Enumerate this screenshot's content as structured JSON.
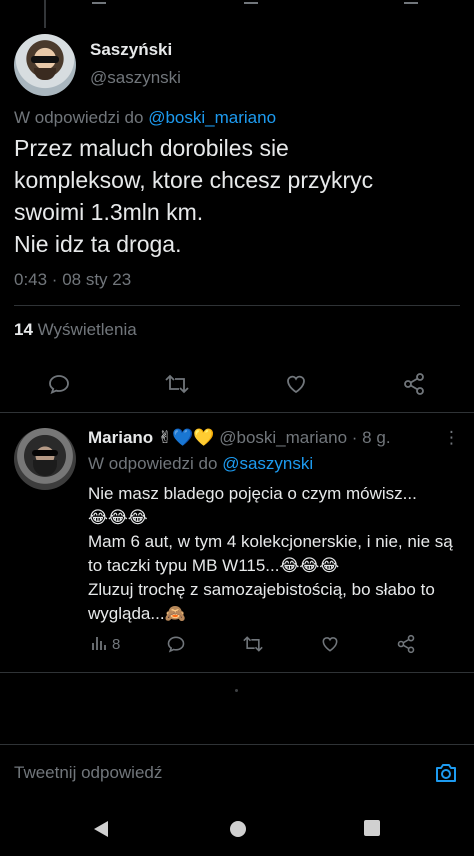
{
  "colors": {
    "accent": "#1d9bf0",
    "muted": "#71767b",
    "text": "#e7e9ea",
    "background": "#000000"
  },
  "main_tweet": {
    "author_name": "Saszyński",
    "author_handle": "@saszynski",
    "reply_prefix": "W odpowiedzi do",
    "reply_to": "@boski_mariano",
    "text": "Przez maluch dorobiles sie\nkompleksow, ktore chcesz przykryc\nswoimi 1.3mln km.\nNie idz ta droga.",
    "timestamp": "0:43 · 08 sty 23",
    "views_count": "14",
    "views_label": "Wyświetlenia",
    "action_icons": [
      "reply-icon",
      "retweet-icon",
      "like-icon",
      "share-icon"
    ]
  },
  "reply_tweet": {
    "author_name": "Mariano",
    "author_emojis": "✌💙💛",
    "author_handle": "@boski_mariano",
    "age": "· 8 g.",
    "more": "⋮",
    "reply_prefix": "W odpowiedzi do",
    "reply_to": "@saszynski",
    "text": "Nie masz bladego pojęcia o czym mówisz...\n😂😂😂\nMam 6 aut, w tym 4 kolekcjonerskie, i nie, nie są to taczki typu MB W115...😂😂😂\nZluzuj trochę z samozajebistością, bo słabo to wygląda...🙈",
    "views_count": "8",
    "action_icons": [
      "views-icon",
      "reply-icon",
      "retweet-icon",
      "like-icon",
      "share-icon"
    ]
  },
  "compose": {
    "placeholder": "Tweetnij odpowiedź",
    "icon": "camera-icon"
  },
  "navbar": {
    "icons": [
      "back-icon",
      "home-icon",
      "recents-icon"
    ]
  }
}
